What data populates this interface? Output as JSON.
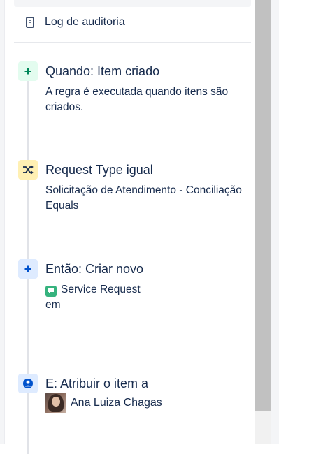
{
  "audit": {
    "label": "Log de auditoria",
    "icon": "document-icon"
  },
  "steps": [
    {
      "title": "Quando: Item criado",
      "description": "A regra é executada quando itens são criados.",
      "icon": "plus-icon",
      "color": "#00875a"
    },
    {
      "title": "Request Type igual",
      "description": "Solicitação de Atendimento - Conciliação Equals",
      "icon": "shuffle-icon",
      "color": "#172b4d"
    },
    {
      "title": "Então: Criar novo",
      "item_type": "Service Request",
      "description_suffix": "em",
      "icon": "plus-icon",
      "color": "#0052cc"
    },
    {
      "title": "E: Atribuir o item a",
      "assignee": "Ana Luiza Chagas",
      "icon": "user-circle-icon",
      "color": "#0052cc"
    }
  ]
}
